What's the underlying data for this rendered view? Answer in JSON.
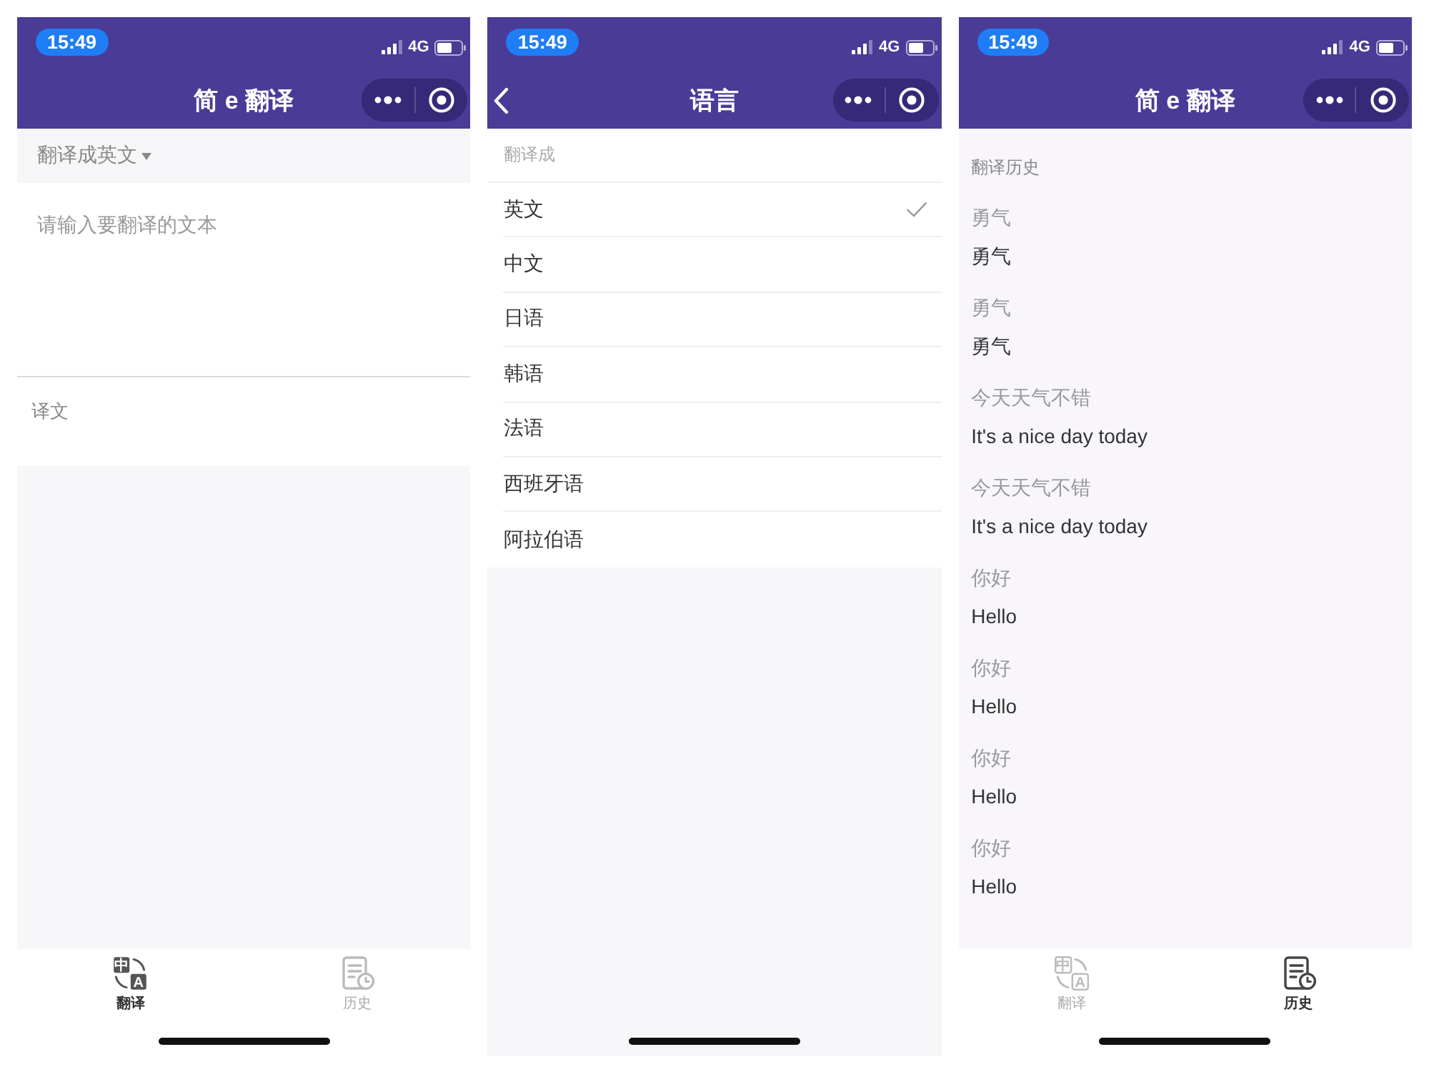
{
  "screens": [
    {
      "kind": "translate",
      "status_bar": {
        "time": "15:49",
        "network": "4G"
      },
      "nav_bar": {
        "title": "简 e 翻译",
        "back_button": false
      },
      "target_language": {
        "label": "翻译成英文"
      },
      "input": {
        "placeholder": "请输入要翻译的文本"
      },
      "output": {
        "label": "译文"
      },
      "tab_bar": [
        {
          "kind": "translate",
          "label": "翻译",
          "selected": true,
          "icon_glyphs": [
            "中",
            "A"
          ]
        },
        {
          "kind": "history",
          "label": "历史",
          "selected": false
        }
      ]
    },
    {
      "kind": "languages",
      "status_bar": {
        "time": "15:49",
        "network": "4G"
      },
      "nav_bar": {
        "title": "语言",
        "back_button": true
      },
      "section_title": "翻译成",
      "languages": [
        {
          "label": "英文",
          "selected": true
        },
        {
          "label": "中文",
          "selected": false
        },
        {
          "label": "日语",
          "selected": false
        },
        {
          "label": "韩语",
          "selected": false
        },
        {
          "label": "法语",
          "selected": false
        },
        {
          "label": "西班牙语",
          "selected": false
        },
        {
          "label": "阿拉伯语",
          "selected": false
        }
      ]
    },
    {
      "kind": "history",
      "status_bar": {
        "time": "15:49",
        "network": "4G"
      },
      "nav_bar": {
        "title": "简 e 翻译",
        "back_button": false
      },
      "section_title": "翻译历史",
      "history": [
        {
          "source": "勇气",
          "translation": "勇气"
        },
        {
          "source": "勇气",
          "translation": "勇气"
        },
        {
          "source": "今天天气不错",
          "translation": "It's a nice day today"
        },
        {
          "source": "今天天气不错",
          "translation": "It's a nice day today"
        },
        {
          "source": "你好",
          "translation": "Hello"
        },
        {
          "source": "你好",
          "translation": "Hello"
        },
        {
          "source": "你好",
          "translation": "Hello"
        },
        {
          "source": "你好",
          "translation": "Hello"
        }
      ],
      "tab_bar": [
        {
          "kind": "translate",
          "label": "翻译",
          "selected": false,
          "icon_glyphs": [
            "中",
            "A"
          ]
        },
        {
          "kind": "history",
          "label": "历史",
          "selected": true
        }
      ]
    }
  ]
}
